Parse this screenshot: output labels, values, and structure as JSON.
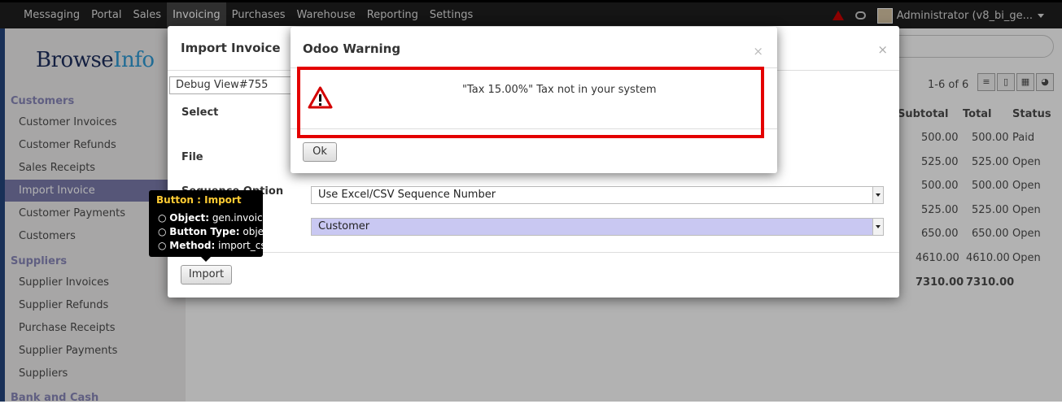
{
  "topbar": {
    "menu": [
      "Messaging",
      "Portal",
      "Sales",
      "Invoicing",
      "Purchases",
      "Warehouse",
      "Reporting",
      "Settings"
    ],
    "active": "Invoicing",
    "user": "Administrator (v8_bi_ge...",
    "alert_icon": "warning-icon",
    "chat_icon": "chat-icon"
  },
  "sidebar": {
    "logo_a": "Browse",
    "logo_b": "Info",
    "sections": [
      {
        "title": "Customers",
        "items": [
          "Customer Invoices",
          "Customer Refunds",
          "Sales Receipts",
          "Import Invoice",
          "Customer Payments",
          "Customers"
        ]
      },
      {
        "title": "Suppliers",
        "items": [
          "Supplier Invoices",
          "Supplier Refunds",
          "Purchase Receipts",
          "Supplier Payments",
          "Suppliers"
        ]
      },
      {
        "title": "Bank and Cash",
        "items": []
      }
    ],
    "active_item": "Import Invoice"
  },
  "list": {
    "pager": "1-6 of 6",
    "headers": [
      "Subtotal",
      "Total",
      "Status"
    ],
    "rows": [
      [
        "500.00",
        "500.00",
        "Paid"
      ],
      [
        "525.00",
        "525.00",
        "Open"
      ],
      [
        "500.00",
        "500.00",
        "Open"
      ],
      [
        "525.00",
        "525.00",
        "Open"
      ],
      [
        "650.00",
        "650.00",
        "Open"
      ],
      [
        "4610.00",
        "4610.00",
        "Open"
      ]
    ],
    "totals": [
      "7310.00",
      "7310.00"
    ]
  },
  "import_dialog": {
    "title": "Import Invoice",
    "close": "×",
    "debug_view": "Debug View#755",
    "labels": {
      "select": "Select",
      "file": "File",
      "sequence_option": "Sequence Option"
    },
    "sequence_value": "Use Excel/CSV Sequence Number",
    "partner_type_value": "Customer",
    "import_button": "Import"
  },
  "tooltip": {
    "title": "Button : Import",
    "object_label": "Object:",
    "object_value": " gen.invoice",
    "type_label": "Button Type:",
    "type_value": " object",
    "method_label": "Method:",
    "method_value": " import_csv"
  },
  "warning": {
    "title": "Odoo Warning",
    "close": "×",
    "message": "\"Tax 15.00%\" Tax not in your system",
    "ok_button": "Ok",
    "icon": "warning-triangle-icon",
    "highlight_color": "#e40000"
  }
}
